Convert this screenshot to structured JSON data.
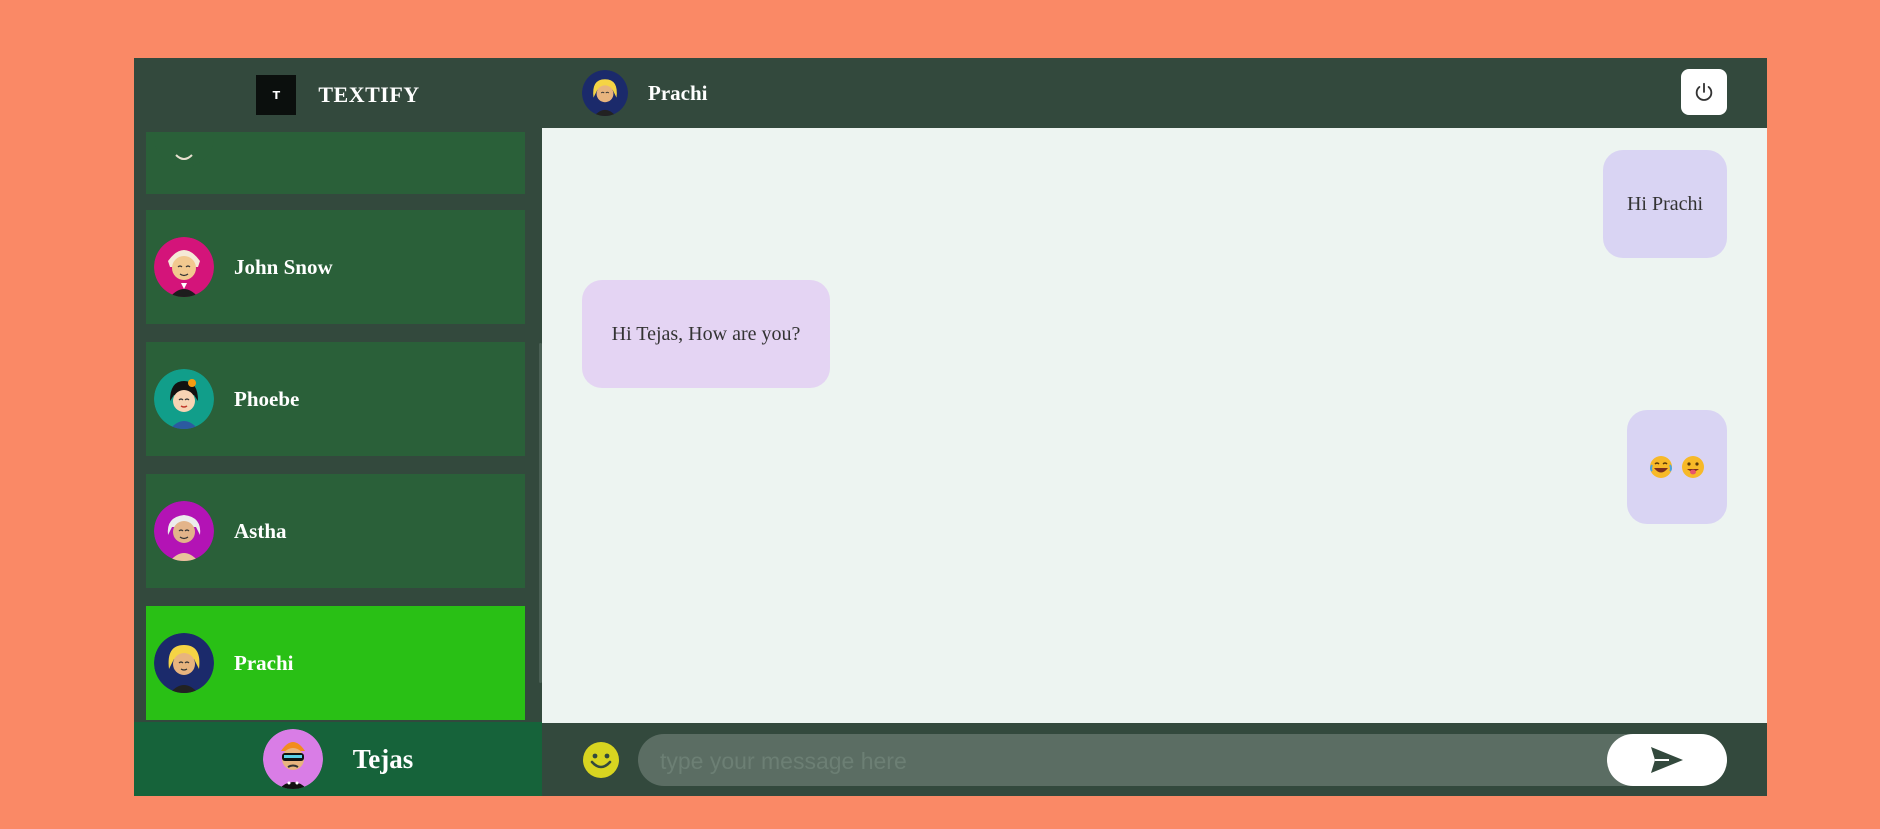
{
  "brand": {
    "logo_text": "T",
    "name": "TEXTIFY"
  },
  "contacts": [
    {
      "name": "",
      "avatar": "partial-avatar",
      "active": false
    },
    {
      "name": "John Snow",
      "avatar": "pink-avatar",
      "active": false
    },
    {
      "name": "Phoebe",
      "avatar": "teal-avatar",
      "active": false
    },
    {
      "name": "Astha",
      "avatar": "purple-avatar",
      "active": false
    },
    {
      "name": "Prachi",
      "avatar": "navy-avatar",
      "active": true
    }
  ],
  "current_user": {
    "name": "Tejas",
    "avatar": "orange-visor-avatar"
  },
  "chat_header": {
    "name": "Prachi",
    "logout_icon": "power-icon"
  },
  "messages": [
    {
      "direction": "out",
      "text": "Hi Prachi"
    },
    {
      "direction": "in",
      "text": "Hi Tejas, How are you?"
    },
    {
      "direction": "out",
      "text": "😂 😛",
      "emojis": [
        "laughing-crying-emoji",
        "tongue-out-emoji"
      ]
    }
  ],
  "composer": {
    "placeholder": "type your message here",
    "value": "",
    "emoji_icon": "smiley-icon",
    "send_icon": "send-icon"
  },
  "colors": {
    "background": "#fa8966",
    "sidebar": "#33493d",
    "contact_item": "#2a6039",
    "contact_active": "#29c015",
    "user_panel": "#16633a",
    "chat_area": "#edf4f1",
    "bubble_out": "#d9d4f3",
    "bubble_in": "#e4d4f3",
    "input": "#5b6d63"
  }
}
